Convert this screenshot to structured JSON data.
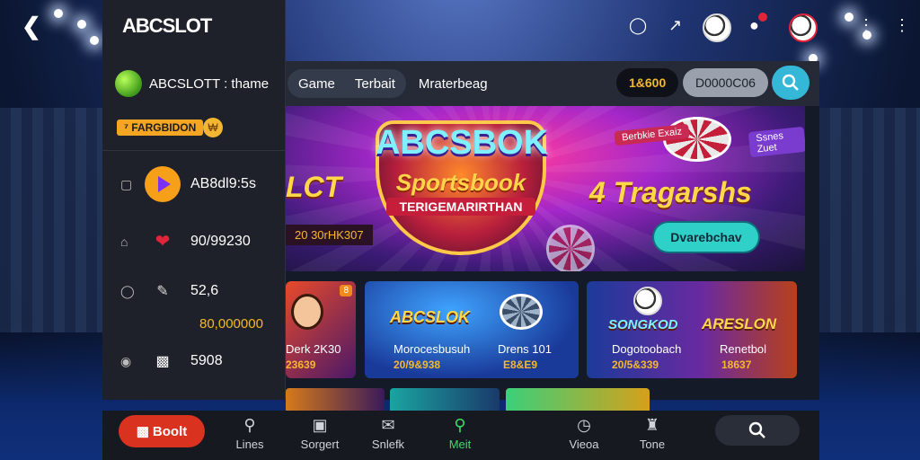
{
  "app": {
    "brand": "ABCSLOT",
    "back_icon": "back-arrow-icon"
  },
  "header_icons": [
    "shield-icon",
    "share-icon",
    "soccer-ball-icon",
    "notification-icon",
    "avatar-ball-icon",
    "more-vertical-icon",
    "more-vertical-icon"
  ],
  "sidebar": {
    "theme_label": "ABCSLOTT : thame",
    "promo_badge": "⁷ FARGBIDON",
    "promo_coin": "₩",
    "rows": [
      {
        "label": "AB8dl9:5s",
        "icon": "play-icon"
      },
      {
        "label": "90/99230",
        "icon": "heart-icon"
      },
      {
        "label": "52,6",
        "icon": "edit-icon"
      },
      {
        "label": "5908",
        "icon": "card-icon"
      }
    ],
    "sub_amount": "80,000000"
  },
  "topbar": {
    "tabs": [
      "Game",
      "Terbait"
    ],
    "plain_tab": "Mraterbeag",
    "balance": "1&600",
    "balance2": "D0000C06"
  },
  "banner": {
    "left_title": "LCT",
    "left_sub": "20 30rHK307",
    "logo_title": "ABCSBOK",
    "logo_sub": "Sportsbook",
    "logo_tag": "TERIGEMARIRTHAN",
    "tag1": "Berbkie Exaiz",
    "tag2": "Ssnes Zuet",
    "right_title": "4 Tragarshs",
    "cta": "Dvarebchav"
  },
  "cards": [
    {
      "title": "",
      "label": "Derk 2K30",
      "value": "23639",
      "corner": "8"
    },
    {
      "title": "ABCSLOK",
      "label": "Morocesbusuh",
      "value": "20/9&938",
      "label2": "Drens 101",
      "value2": "E8&E9"
    },
    {
      "title": "SONGKOD",
      "label": "Dogotoobach",
      "value": "20/5&339",
      "title2": "ARESLON",
      "label2": "Renetbol",
      "value2": "18637"
    }
  ],
  "bottom_nav": {
    "bet_label": "Boolt",
    "items": [
      {
        "label": "Lines",
        "icon": "location-icon"
      },
      {
        "label": "Sorgert",
        "icon": "box-icon"
      },
      {
        "label": "Snlefk",
        "icon": "chat-icon"
      },
      {
        "label": "Meit",
        "icon": "search-icon"
      },
      {
        "label": "Vieoa",
        "icon": "clock-icon"
      },
      {
        "label": "Tone",
        "icon": "gamepad-icon"
      }
    ]
  },
  "colors": {
    "accent": "#35b7d7",
    "gold": "#f5b82d",
    "bet_red": "#d9321f",
    "active_green": "#3ddc6a"
  }
}
